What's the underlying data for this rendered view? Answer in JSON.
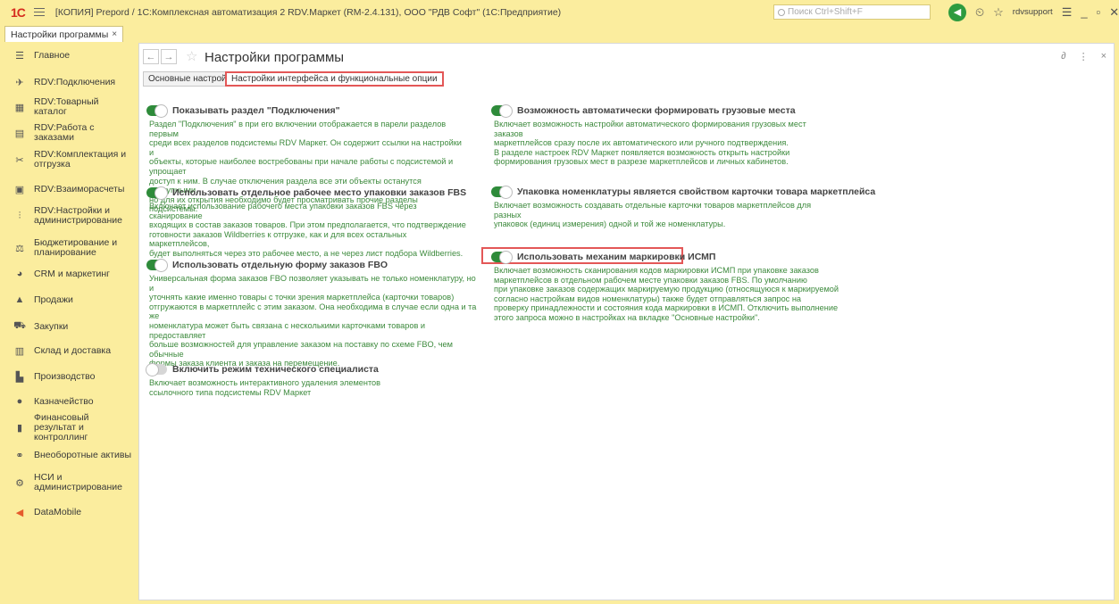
{
  "titlebar": {
    "logo": "1С",
    "title": "[КОПИЯ] Prepord / 1С:Комплексная автоматизация 2 RDV.Маркет (RM-2.4.131), ООО \"РДВ Софт\" (1С:Предприятие)",
    "search_placeholder": "Поиск Ctrl+Shift+F",
    "user": "rdvsupport"
  },
  "open_tab": {
    "label": "Настройки программы",
    "close": "×"
  },
  "sidebar": {
    "items": [
      {
        "label": "Главное",
        "icon": "menu-icon",
        "glyph": "☰"
      },
      {
        "label": "RDV:Подключения",
        "icon": "rocket-icon",
        "glyph": "✈"
      },
      {
        "label": "RDV:Товарный каталог",
        "icon": "grid-icon",
        "glyph": "▦"
      },
      {
        "label": "RDV:Работа с заказами",
        "icon": "document-icon",
        "glyph": "▤"
      },
      {
        "label": "RDV:Комплектация и отгрузка",
        "icon": "tools-icon",
        "glyph": "✂"
      },
      {
        "label": "RDV:Взаиморасчеты",
        "icon": "calculator-icon",
        "glyph": "▣"
      },
      {
        "label": "RDV:Настройки и администрирование",
        "icon": "sliders-icon",
        "glyph": "⫶"
      },
      {
        "label": "Бюджетирование и планирование",
        "icon": "budget-icon",
        "glyph": "⚖"
      },
      {
        "label": "CRM и маркетинг",
        "icon": "pie-icon",
        "glyph": "◕"
      },
      {
        "label": "Продажи",
        "icon": "bag-icon",
        "glyph": "▲"
      },
      {
        "label": "Закупки",
        "icon": "cart-icon",
        "glyph": "⛟"
      },
      {
        "label": "Склад и доставка",
        "icon": "warehouse-icon",
        "glyph": "▥"
      },
      {
        "label": "Производство",
        "icon": "factory-icon",
        "glyph": "▙"
      },
      {
        "label": "Казначейство",
        "icon": "money-icon",
        "glyph": "●"
      },
      {
        "label": "Финансовый результат и контроллинг",
        "icon": "chart-icon",
        "glyph": "▮"
      },
      {
        "label": "Внеоборотные активы",
        "icon": "handshake-icon",
        "glyph": "⚭"
      },
      {
        "label": "НСИ и администрирование",
        "icon": "gear-icon",
        "glyph": "⚙"
      },
      {
        "label": "DataMobile",
        "icon": "datamobile-icon",
        "glyph": "◀"
      }
    ]
  },
  "page": {
    "title": "Настройки программы",
    "tabs": [
      "Основные настройки",
      "Настройки интерфейса и функциональные опции"
    ]
  },
  "settings": [
    {
      "title": "Показывать раздел \"Подключения\"",
      "enabled": true,
      "desc": [
        "Раздел \"Подключения\" в при его включении отображается в парели разделов первым",
        "среди всех разделов подсистемы RDV Маркет. Он содержит ссылки на настройки и",
        "объекты, которые наиболее востребованы при начале работы с подсистемой и упрощает",
        "доступ к ним. В случае отключения раздела все эти объекты останутся доступными,",
        "но для их открытия необходимо будет просматривать прочие разделы подсистемы."
      ]
    },
    {
      "title": "Использовать отдельное рабочее место упаковки заказов FBS",
      "enabled": true,
      "desc": [
        "Включает использование рабочего места упаковки заказов FBS через сканирование",
        "входящих в состав заказов товаров. При этом предполагается, что подтверждение",
        "готовности заказов Wildberries к отгрузке, как и для всех остальных маркетплейсов,",
        "будет выполняться через это рабочее место, а не через лист подбора Wildberries."
      ]
    },
    {
      "title": "Использовать отдельную форму заказов FBO",
      "enabled": true,
      "desc": [
        "Универсальная форма заказов FBO позволяет указывать не только номенклатуру, но и",
        "уточнять какие именно товары с точки зрения маркетплейса (карточки товаров)",
        "отгружаются в маркетплейс с этим заказом. Она необходима в случае если одна и та же",
        "номенклатура может быть связана с несколькими карточками товаров и предоставляет",
        "больше возможностей для управление заказом на поставку по схеме FBO, чем обычные",
        "формы заказа клиента и заказа на перемещение."
      ]
    },
    {
      "title": "Включить режим технического специалиста",
      "enabled": false,
      "desc": [
        "Включает возможность интерактивного удаления элементов",
        "ссылочного типа подсистемы RDV Маркет"
      ]
    },
    {
      "title": "Возможность автоматически формировать грузовые места",
      "enabled": true,
      "desc": [
        "Включает возможность настройки автоматического формирования грузовых мест заказов",
        "маркетплейсов сразу после их автоматического или ручного подтверждения.",
        "В разделе настроек RDV Маркет появляется возможность открыть настройки",
        "формирования грузовых мест в разрезе маркетплейсов и личных кабинетов."
      ]
    },
    {
      "title": "Упаковка номенклатуры является свойством карточки товара маркетплейса",
      "enabled": true,
      "desc": [
        "Включает возможность создавать отдельные карточки товаров маркетплейсов для разных",
        "упаковок (единиц измерения) одной и той же номенклатуры."
      ]
    },
    {
      "title": "Использовать механим маркировки ИСМП",
      "enabled": true,
      "desc": [
        "Включает возможность сканирования кодов маркировки ИСМП при упаковке заказов",
        "маркетплейсов в отдельном рабочем месте упаковки заказов FBS. По умолчанию",
        "при упаковке заказов содержащих маркируемую продукцию (относящуюся к маркируемой",
        "согласно настройкам видов номенклатуры) также будет отправляться запрос на",
        "проверку принадлежности и состояния кода маркировки в ИСМП. Отключить выполнение",
        "этого запроса можно в настройках на вкладке \"Основные настройки\"."
      ]
    }
  ],
  "colors": {
    "accent_green": "#2e8b3a",
    "highlight_red": "#e35757",
    "sidebar_bg": "#fbed9e",
    "desc_text": "#3d8a3d"
  }
}
